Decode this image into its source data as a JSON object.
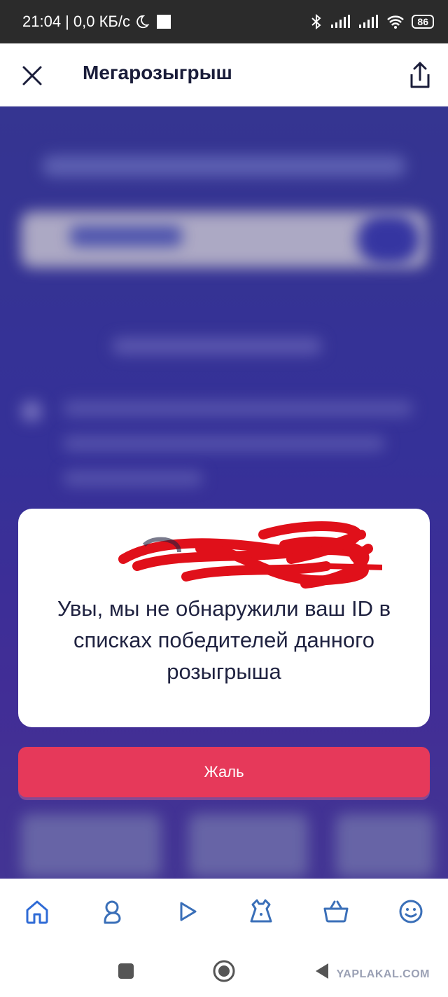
{
  "status_bar": {
    "time": "21:04",
    "network_speed": "| 0,0 КБ/с",
    "battery": "86",
    "icons": [
      "moon-icon",
      "notification-square-icon",
      "bluetooth-icon",
      "signal-icon",
      "signal-icon",
      "wifi-icon",
      "battery-icon"
    ]
  },
  "header": {
    "title": "Мегарозыгрыш",
    "close_icon": "close-icon",
    "share_icon": "share-icon"
  },
  "modal": {
    "message": "Увы, мы не обнаружили ваш ID в списках победителей данного розыгрыша",
    "redaction_color": "#e0101a"
  },
  "primary_button": {
    "label": "Жаль",
    "color": "#e6395a"
  },
  "bottom_nav": {
    "items": [
      {
        "icon": "home-icon",
        "active": true
      },
      {
        "icon": "baby-icon",
        "active": false
      },
      {
        "icon": "play-icon",
        "active": false
      },
      {
        "icon": "dress-icon",
        "active": false
      },
      {
        "icon": "basket-icon",
        "active": false
      },
      {
        "icon": "smiley-icon",
        "active": false
      }
    ],
    "active_color": "#2f6bd6",
    "inactive_color": "#3a6fb8"
  },
  "system_nav": {
    "icons": [
      "recent-apps-icon",
      "home-circle-icon",
      "back-icon"
    ]
  },
  "watermark": "YAPLAKAL.COM"
}
